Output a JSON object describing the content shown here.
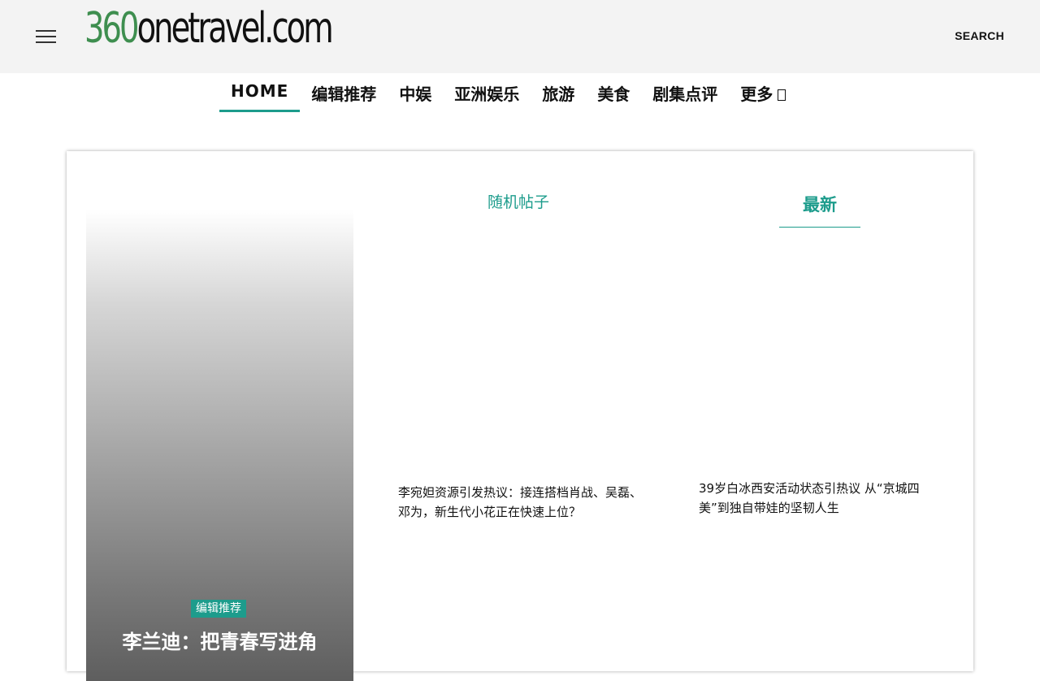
{
  "header": {
    "menu_icon": "hamburger-menu-icon",
    "logo_digits": "360",
    "logo_rest": "onetravel.com",
    "search_label": "SEARCH"
  },
  "nav": {
    "items": [
      {
        "label": "HOME",
        "active": true
      },
      {
        "label": "编辑推荐"
      },
      {
        "label": "中娱"
      },
      {
        "label": "亚洲娱乐"
      },
      {
        "label": "旅游"
      },
      {
        "label": "美食"
      },
      {
        "label": "剧集点评"
      },
      {
        "label": "更多",
        "icon": "box-glyph-icon"
      }
    ]
  },
  "feature": {
    "tag": "编辑推荐",
    "title": "李兰迪：把青春写进角"
  },
  "random_posts": {
    "heading": "随机帖子",
    "post_title": "李宛妲资源引发热议：接连搭档肖战、吴磊、邓为，新生代小花正在快速上位？"
  },
  "latest_posts": {
    "heading": "最新",
    "post_title": "39岁白冰西安活动状态引热议 从“京城四美”到独自带娃的坚韧人生"
  },
  "colors": {
    "accent": "#1d9c8c",
    "logo_green": "#3e8e4f",
    "topbar_bg": "#f3f3f3"
  }
}
